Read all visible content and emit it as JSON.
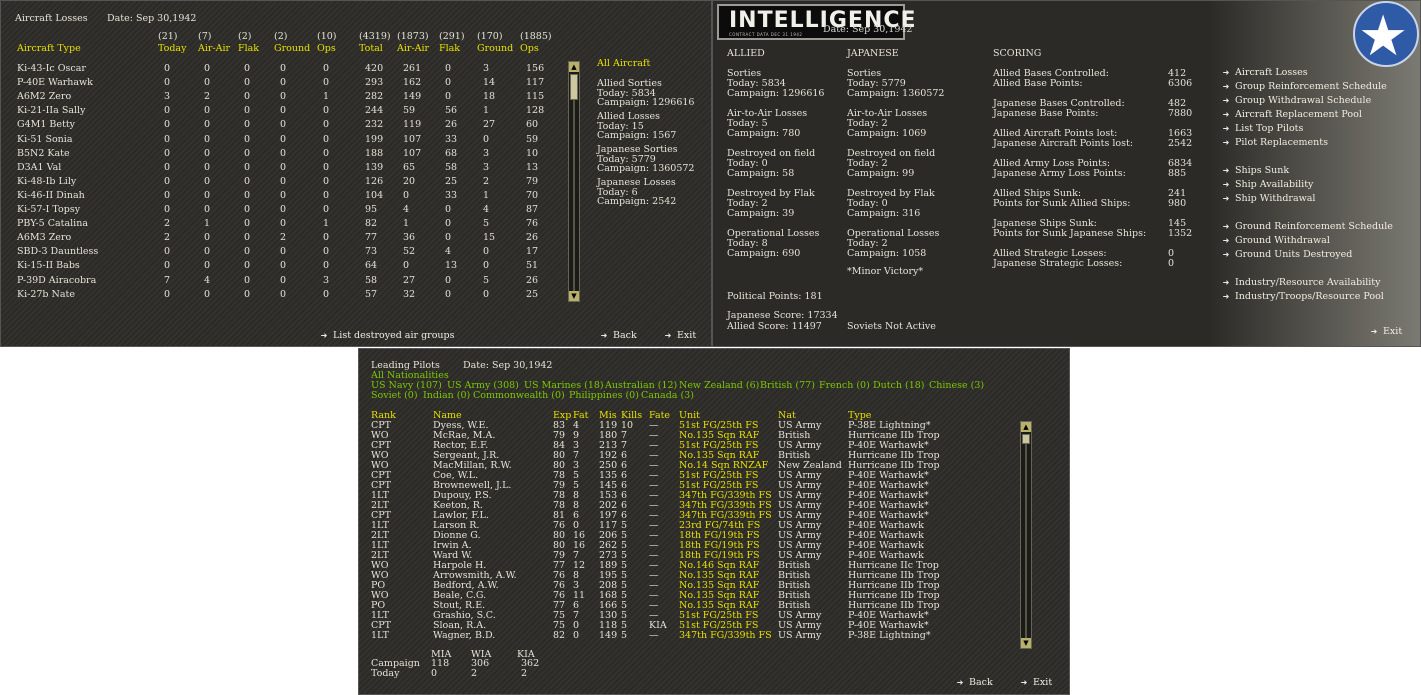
{
  "losses": {
    "title": "Aircraft Losses",
    "date": "Date: Sep 30,1942",
    "total_counts": [
      "(21)",
      "(7)",
      "(2)",
      "(2)",
      "(10)",
      "(4319)",
      "(1873)",
      "(291)",
      "(170)",
      "(1885)"
    ],
    "headers": [
      "Aircraft Type",
      "Today",
      "Air-Air",
      "Flak",
      "Ground",
      "Ops",
      "Total",
      "Air-Air",
      "Flak",
      "Ground",
      "Ops"
    ],
    "rows": [
      [
        "Ki-43-Ic Oscar",
        "0",
        "0",
        "0",
        "0",
        "0",
        "420",
        "261",
        "0",
        "3",
        "156"
      ],
      [
        "P-40E Warhawk",
        "0",
        "0",
        "0",
        "0",
        "0",
        "293",
        "162",
        "0",
        "14",
        "117"
      ],
      [
        "A6M2 Zero",
        "3",
        "2",
        "0",
        "0",
        "1",
        "282",
        "149",
        "0",
        "18",
        "115"
      ],
      [
        "Ki-21-IIa Sally",
        "0",
        "0",
        "0",
        "0",
        "0",
        "244",
        "59",
        "56",
        "1",
        "128"
      ],
      [
        "G4M1 Betty",
        "0",
        "0",
        "0",
        "0",
        "0",
        "232",
        "119",
        "26",
        "27",
        "60"
      ],
      [
        "Ki-51 Sonia",
        "0",
        "0",
        "0",
        "0",
        "0",
        "199",
        "107",
        "33",
        "0",
        "59"
      ],
      [
        "B5N2 Kate",
        "0",
        "0",
        "0",
        "0",
        "0",
        "188",
        "107",
        "68",
        "3",
        "10"
      ],
      [
        "D3A1 Val",
        "0",
        "0",
        "0",
        "0",
        "0",
        "139",
        "65",
        "58",
        "3",
        "13"
      ],
      [
        "Ki-48-Ib Lily",
        "0",
        "0",
        "0",
        "0",
        "0",
        "126",
        "20",
        "25",
        "2",
        "79"
      ],
      [
        "Ki-46-II Dinah",
        "0",
        "0",
        "0",
        "0",
        "0",
        "104",
        "0",
        "33",
        "1",
        "70"
      ],
      [
        "Ki-57-I Topsy",
        "0",
        "0",
        "0",
        "0",
        "0",
        "95",
        "4",
        "0",
        "4",
        "87"
      ],
      [
        "PBY-5 Catalina",
        "2",
        "1",
        "0",
        "0",
        "1",
        "82",
        "1",
        "0",
        "5",
        "76"
      ],
      [
        "A6M3 Zero",
        "2",
        "0",
        "0",
        "2",
        "0",
        "77",
        "36",
        "0",
        "15",
        "26"
      ],
      [
        "SBD-3 Dauntless",
        "0",
        "0",
        "0",
        "0",
        "0",
        "73",
        "52",
        "4",
        "0",
        "17"
      ],
      [
        "Ki-15-II Babs",
        "0",
        "0",
        "0",
        "0",
        "0",
        "64",
        "0",
        "13",
        "0",
        "51"
      ],
      [
        "P-39D Airacobra",
        "7",
        "4",
        "0",
        "0",
        "3",
        "58",
        "27",
        "0",
        "5",
        "26"
      ],
      [
        "Ki-27b Nate",
        "0",
        "0",
        "0",
        "0",
        "0",
        "57",
        "32",
        "0",
        "0",
        "25"
      ]
    ],
    "side_title": "All Aircraft",
    "side": [
      [
        "Allied Sorties",
        "Today:   5834",
        "Campaign: 1296616"
      ],
      [
        "Allied Losses",
        "Today:   15",
        "Campaign: 1567"
      ],
      [
        "Japanese Sorties",
        "Today:   5779",
        "Campaign: 1360572"
      ],
      [
        "Japanese Losses",
        "Today:   6",
        "Campaign: 2542"
      ]
    ],
    "list_destroyed": "List destroyed air groups",
    "back": "Back",
    "exit": "Exit"
  },
  "intel": {
    "logo": "INTELLIGENCE",
    "logo_sub": "CONTRACT DATA DEC 31 1942",
    "date": "Date: Sep 30,1942",
    "allied_header": "ALLIED",
    "japanese_header": "JAPANESE",
    "scoring_header": "SCORING",
    "allied": [
      [
        "Sorties",
        "Today:    5834",
        "Campaign: 1296616"
      ],
      [
        "Air-to-Air Losses",
        "Today:    5",
        "Campaign: 780"
      ],
      [
        "Destroyed on field",
        "Today:    0",
        "Campaign: 58"
      ],
      [
        "Destroyed by Flak",
        "Today:    2",
        "Campaign: 39"
      ],
      [
        "Operational Losses",
        "Today:    8",
        "Campaign: 690"
      ]
    ],
    "japanese": [
      [
        "Sorties",
        "Today:    5779",
        "Campaign: 1360572"
      ],
      [
        "Air-to-Air Losses",
        "Today:    2",
        "Campaign: 1069"
      ],
      [
        "Destroyed on field",
        "Today:    2",
        "Campaign: 99"
      ],
      [
        "Destroyed by Flak",
        "Today:    0",
        "Campaign: 316"
      ],
      [
        "Operational Losses",
        "Today:    2",
        "Campaign: 1058"
      ]
    ],
    "victory": "*Minor Victory*",
    "political": "Political Points:  181",
    "jap_score": "Japanese Score:  17334",
    "allied_score": "Allied Score:  11497",
    "soviets": "Soviets Not Active",
    "scoring": [
      [
        "Allied Bases Controlled:",
        "412",
        "Allied Base Points:",
        "6306"
      ],
      [
        "Japanese Bases Controlled:",
        "482",
        "Japanese Base Points:",
        "7880"
      ],
      [
        "Allied Aircraft Points lost:",
        "1663",
        "Japanese Aircraft Points lost:",
        "2542"
      ],
      [
        "Allied Army Loss Points:",
        "6834",
        "Japanese Army Loss Points:",
        "885"
      ],
      [
        "Allied Ships Sunk:",
        "241",
        "Points for Sunk Allied Ships:",
        "980"
      ],
      [
        "Japanese Ships Sunk:",
        "145",
        "Points for Sunk Japanese Ships:",
        "1352"
      ],
      [
        "Allied Strategic Losses:",
        "0",
        "Japanese Strategic Losses:",
        "0"
      ]
    ],
    "menu1": [
      "Aircraft Losses",
      "Group Reinforcement Schedule",
      "Group Withdrawal Schedule",
      "Aircraft Replacement Pool",
      "List Top Pilots",
      "Pilot Replacements"
    ],
    "menu2": [
      "Ships Sunk",
      "Ship Availability",
      "Ship Withdrawal"
    ],
    "menu3": [
      "Ground Reinforcement Schedule",
      "Ground Withdrawal",
      "Ground Units Destroyed"
    ],
    "menu4": [
      "Industry/Resource Availability",
      "Industry/Troops/Resource Pool"
    ],
    "exit": "Exit"
  },
  "pilots": {
    "title": "Leading Pilots",
    "date": "Date: Sep 30,1942",
    "all_nat": "All Nationalities",
    "filters1": [
      "US Navy (107)",
      "US Army (308)",
      "US Marines (18)",
      "Australian (12)",
      "New Zealand (6)",
      "British (77)",
      "French (0)",
      "Dutch (18)",
      "Chinese (3)"
    ],
    "filters2": [
      "Soviet (0)",
      "Indian (0)",
      "Commonwealth (0)",
      "Philippines (0)",
      "Canada (3)"
    ],
    "headers": [
      "Rank",
      "Name",
      "Exp",
      "Fat",
      "Mis",
      "Kills",
      "Fate",
      "Unit",
      "Nat",
      "Type"
    ],
    "rows": [
      [
        "CPT",
        "Dyess, W.E.",
        "83",
        "4",
        "119",
        "10",
        "—",
        "51st FG/25th FS",
        "US Army",
        "P-38E Lightning*"
      ],
      [
        "WO",
        "McRae, M.A.",
        "79",
        "9",
        "180",
        "7",
        "—",
        "No.135 Sqn RAF",
        "British",
        "Hurricane IIb Trop"
      ],
      [
        "CPT",
        "Rector, E.F.",
        "84",
        "3",
        "213",
        "7",
        "—",
        "51st FG/25th FS",
        "US Army",
        "P-40E Warhawk*"
      ],
      [
        "WO",
        "Sergeant, J.R.",
        "80",
        "7",
        "192",
        "6",
        "—",
        "No.135 Sqn RAF",
        "British",
        "Hurricane IIb Trop"
      ],
      [
        "WO",
        "MacMillan, R.W.",
        "80",
        "3",
        "250",
        "6",
        "—",
        "No.14 Sqn RNZAF",
        "New Zealand",
        "Hurricane IIb Trop"
      ],
      [
        "CPT",
        "Coe, W.L.",
        "78",
        "5",
        "135",
        "6",
        "—",
        "51st FG/25th FS",
        "US Army",
        "P-40E Warhawk*"
      ],
      [
        "CPT",
        "Brownewell, J.L.",
        "79",
        "5",
        "145",
        "6",
        "—",
        "51st FG/25th FS",
        "US Army",
        "P-40E Warhawk*"
      ],
      [
        "1LT",
        "Dupouy, P.S.",
        "78",
        "8",
        "153",
        "6",
        "—",
        "347th FG/339th FS",
        "US Army",
        "P-40E Warhawk*"
      ],
      [
        "2LT",
        "Keeton, R.",
        "78",
        "8",
        "202",
        "6",
        "—",
        "347th FG/339th FS",
        "US Army",
        "P-40E Warhawk*"
      ],
      [
        "CPT",
        "Lawlor, F.L.",
        "81",
        "6",
        "197",
        "6",
        "—",
        "347th FG/339th FS",
        "US Army",
        "P-40E Warhawk*"
      ],
      [
        "1LT",
        "Larson R.",
        "76",
        "0",
        "117",
        "5",
        "—",
        "23rd FG/74th FS",
        "US Army",
        "P-40E Warhawk"
      ],
      [
        "2LT",
        "Dionne G.",
        "80",
        "16",
        "206",
        "5",
        "—",
        "18th FG/19th FS",
        "US Army",
        "P-40E Warhawk"
      ],
      [
        "1LT",
        "Irwin A.",
        "80",
        "16",
        "262",
        "5",
        "—",
        "18th FG/19th FS",
        "US Army",
        "P-40E Warhawk"
      ],
      [
        "2LT",
        "Ward W.",
        "79",
        "7",
        "273",
        "5",
        "—",
        "18th FG/19th FS",
        "US Army",
        "P-40E Warhawk"
      ],
      [
        "WO",
        "Harpole H.",
        "77",
        "12",
        "189",
        "5",
        "—",
        "No.146 Sqn RAF",
        "British",
        "Hurricane IIc Trop"
      ],
      [
        "WO",
        "Arrowsmith, A.W.",
        "76",
        "8",
        "195",
        "5",
        "—",
        "No.135 Sqn RAF",
        "British",
        "Hurricane IIb Trop"
      ],
      [
        "PO",
        "Bedford, A.W.",
        "76",
        "3",
        "208",
        "5",
        "—",
        "No.135 Sqn RAF",
        "British",
        "Hurricane IIb Trop"
      ],
      [
        "WO",
        "Beale, C.G.",
        "76",
        "11",
        "168",
        "5",
        "—",
        "No.135 Sqn RAF",
        "British",
        "Hurricane IIb Trop"
      ],
      [
        "PO",
        "Stout, R.E.",
        "77",
        "6",
        "166",
        "5",
        "—",
        "No.135 Sqn RAF",
        "British",
        "Hurricane IIb Trop"
      ],
      [
        "1LT",
        "Grashio, S.C.",
        "75",
        "7",
        "130",
        "5",
        "—",
        "51st FG/25th FS",
        "US Army",
        "P-40E Warhawk*"
      ],
      [
        "CPT",
        "Sloan, R.A.",
        "75",
        "0",
        "118",
        "5",
        "KIA",
        "51st FG/25th FS",
        "US Army",
        "P-40E Warhawk*"
      ],
      [
        "1LT",
        "Wagner, B.D.",
        "82",
        "0",
        "149",
        "5",
        "—",
        "347th FG/339th FS",
        "US Army",
        "P-38E Lightning*"
      ]
    ],
    "summary_headers": [
      "MIA",
      "WIA",
      "KIA"
    ],
    "summary_campaign": [
      "Campaign",
      "118",
      "306",
      "362"
    ],
    "summary_today": [
      "Today",
      "0",
      "2",
      "2"
    ],
    "back": "Back",
    "exit": "Exit"
  }
}
